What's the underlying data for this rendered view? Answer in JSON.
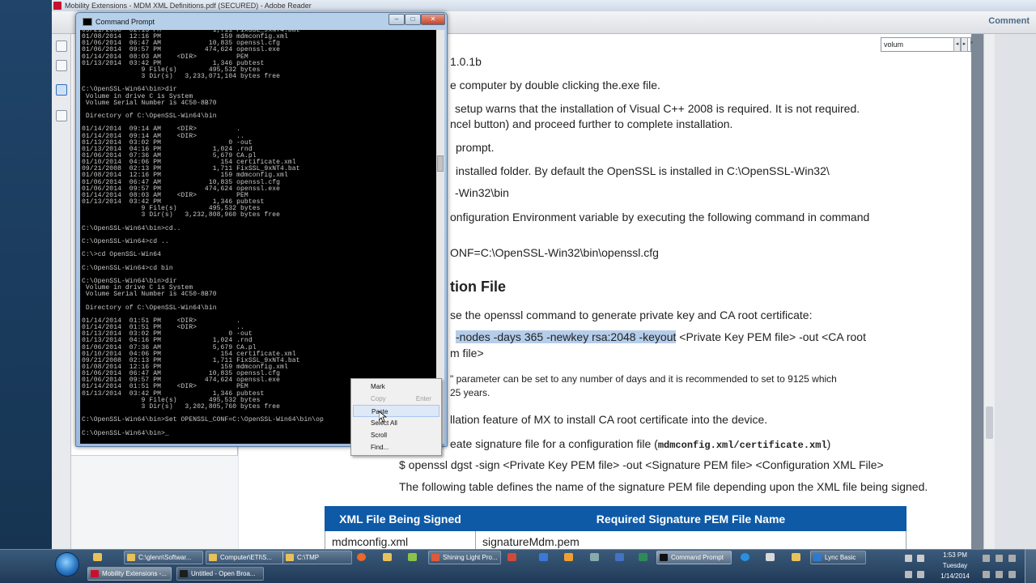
{
  "reader": {
    "title": "Mobility Extensions - MDM XML Definitions.pdf (SECURED) - Adobe Reader",
    "comment_label": "Comment",
    "search_value": "volum",
    "prev_label": "◂",
    "next_label": "▸",
    "close_label": "×",
    "doc_lines": [
      "1.0.1b",
      "e computer by double clicking the.exe file.",
      "setup warns that the installation of Visual C++ 2008 is required. It is not required.",
      "ncel button) and proceed further to complete installation.",
      "prompt.",
      "installed folder. By default the OpenSSL is installed in C:\\OpenSSL-Win32\\",
      "-Win32\\bin",
      "onfiguration Environment variable by executing the following command in command",
      "ONF=C:\\OpenSSL-Win32\\bin\\openssl.cfg",
      "se the openssl command to generate private key and CA root certificate:",
      "m file>",
      "\" parameter can be set to any number of days and it is recommended to set to 9125 which",
      "25 years.",
      "llation feature of MX to install CA root certificate into the device.",
      "eate signature file for a configuration file (",
      "mdmconfig.xml/certificate.xml",
      ")",
      "$ openssl dgst -sign <Private Key PEM file> -out <Signature PEM file>  <Configuration XML File>",
      "The following table defines the name of the signature PEM file depending upon the XML file being signed."
    ],
    "highlight_text": "-nodes -days 365 -newkey rsa:2048 -keyout",
    "after_highlight": " <Private Key PEM file> -out <CA root",
    "heading": "tion File",
    "table": {
      "headers": [
        "XML File Being Signed",
        "Required Signature PEM File Name"
      ],
      "rows": [
        [
          "mdmconfig.xml",
          "signatureMdm.pem"
        ]
      ]
    }
  },
  "cmd": {
    "title": "Command Prompt",
    "min_label": "–",
    "max_label": "□",
    "close_label": "✕",
    "lines": [
      "09/21/2008  02:13 PM             1,711 FixSSL_9xNT4.bat",
      "01/08/2014  12:16 PM               159 mdmconfig.xml",
      "01/06/2014  06:47 AM            10,835 openssl.cfg",
      "01/06/2014  09:57 PM           474,624 openssl.exe",
      "01/14/2014  08:03 AM    <DIR>          PEM",
      "01/13/2014  03:42 PM             1,346 pubtest",
      "               9 File(s)        495,532 bytes",
      "               3 Dir(s)   3,233,071,104 bytes free",
      "",
      "C:\\OpenSSL-Win64\\bin>dir",
      " Volume in drive C is System",
      " Volume Serial Number is 4C50-8B70",
      "",
      " Directory of C:\\OpenSSL-Win64\\bin",
      "",
      "01/14/2014  09:14 AM    <DIR>          .",
      "01/14/2014  09:14 AM    <DIR>          ..",
      "01/13/2014  03:02 PM                 0 -out",
      "01/13/2014  04:16 PM             1,024 .rnd",
      "01/06/2014  07:36 AM             5,679 CA.pl",
      "01/10/2014  04:06 PM               154 certificate.xml",
      "09/21/2008  02:13 PM             1,711 FixSSL_9xNT4.bat",
      "01/08/2014  12:16 PM               159 mdmconfig.xml",
      "01/06/2014  06:47 AM            10,835 openssl.cfg",
      "01/06/2014  09:57 PM           474,624 openssl.exe",
      "01/14/2014  08:03 AM    <DIR>          PEM",
      "01/13/2014  03:42 PM             1,346 pubtest",
      "               9 File(s)        495,532 bytes",
      "               3 Dir(s)   3,232,808,960 bytes free",
      "",
      "C:\\OpenSSL-Win64\\bin>cd..",
      "",
      "C:\\OpenSSL-Win64>cd ..",
      "",
      "C:\\>cd OpenSSL-Win64",
      "",
      "C:\\OpenSSL-Win64>cd bin",
      "",
      "C:\\OpenSSL-Win64\\bin>dir",
      " Volume in drive C is System",
      " Volume Serial Number is 4C50-8B70",
      "",
      " Directory of C:\\OpenSSL-Win64\\bin",
      "",
      "01/14/2014  01:51 PM    <DIR>          .",
      "01/14/2014  01:51 PM    <DIR>          ..",
      "01/13/2014  03:02 PM                 0 -out",
      "01/13/2014  04:16 PM             1,024 .rnd",
      "01/06/2014  07:36 AM             5,679 CA.pl",
      "01/10/2014  04:06 PM               154 certificate.xml",
      "09/21/2008  02:13 PM             1,711 FixSSL_9xNT4.bat",
      "01/08/2014  12:16 PM               159 mdmconfig.xml",
      "01/06/2014  06:47 AM            10,835 openssl.cfg",
      "01/06/2014  09:57 PM           474,624 openssl.exe",
      "01/14/2014  01:51 PM    <DIR>          PEM",
      "01/13/2014  03:42 PM             1,346 pubtest",
      "               9 File(s)        495,532 bytes",
      "               3 Dir(s)   3,202,805,760 bytes free",
      "",
      "C:\\OpenSSL-Win64\\bin>Set OPENSSL_CONF=C:\\OpenSSL-Win64\\bin\\op",
      "",
      "C:\\OpenSSL-Win64\\bin>_"
    ]
  },
  "context_menu": {
    "items": [
      {
        "label": "Mark",
        "shortcut": "",
        "state": "normal"
      },
      {
        "label": "Copy",
        "shortcut": "Enter",
        "state": "disabled"
      },
      {
        "label": "Paste",
        "shortcut": "",
        "state": "active"
      },
      {
        "label": "Select All",
        "shortcut": "",
        "state": "normal"
      },
      {
        "label": "Scroll",
        "shortcut": "",
        "state": "normal"
      },
      {
        "label": "Find...",
        "shortcut": "",
        "state": "normal"
      }
    ]
  },
  "taskbar": {
    "top_row": [
      {
        "label": "C:\\glenn\\Softwar...",
        "color": "#e8c15a",
        "active": false
      },
      {
        "label": "Computer\\ETI\\S...",
        "color": "#e8c15a",
        "active": false
      },
      {
        "label": "C:\\TMP",
        "color": "#e8c15a",
        "active": false
      },
      {
        "label": "Shining Light Pro...",
        "color": "#de5a3c",
        "active": false
      },
      {
        "label": "Command Prompt",
        "color": "#111111",
        "active": true
      },
      {
        "label": "Lync Basic",
        "color": "#2b7bd1",
        "active": false
      }
    ],
    "bottom_row": [
      {
        "label": "Mobility Extensions -...",
        "color": "#c8102e",
        "active": true
      },
      {
        "label": "Untitled - Open Broa...",
        "color": "#1d1d1d",
        "active": false
      }
    ],
    "clock_time": "1:53 PM",
    "clock_day": "Tuesday",
    "clock_date": "1/14/2014"
  }
}
